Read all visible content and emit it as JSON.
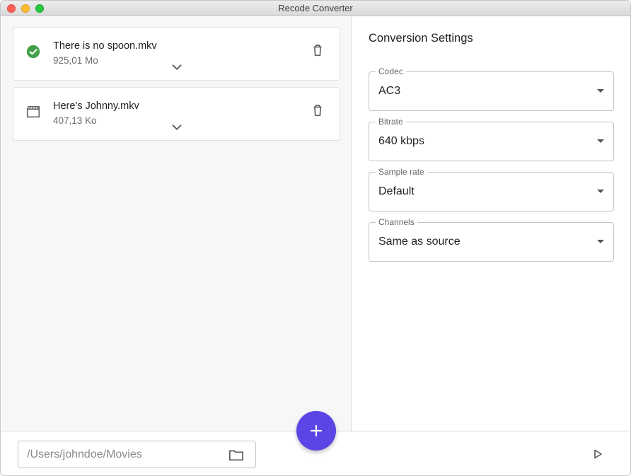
{
  "window": {
    "title": "Recode Converter"
  },
  "files": [
    {
      "name": "There is no spoon.mkv",
      "size": "925,01 Mo",
      "status_icon": "check-circle-icon",
      "status_color": "#43a047"
    },
    {
      "name": "Here's Johnny.mkv",
      "size": "407,13 Ko",
      "status_icon": "movie-clapper-icon",
      "status_color": "#666666"
    }
  ],
  "settings": {
    "title": "Conversion Settings",
    "codec": {
      "label": "Codec",
      "value": "AC3"
    },
    "bitrate": {
      "label": "Bitrate",
      "value": "640 kbps"
    },
    "sample_rate": {
      "label": "Sample rate",
      "value": "Default"
    },
    "channels": {
      "label": "Channels",
      "value": "Same as source"
    }
  },
  "output": {
    "path_placeholder": "/Users/johndoe/Movies"
  },
  "colors": {
    "accent": "#5b45e5",
    "success": "#43a047"
  },
  "icons": {
    "add": "plus-icon",
    "folder": "folder-icon",
    "start": "play-icon",
    "delete": "trash-icon",
    "expand": "chevron-down-icon"
  }
}
